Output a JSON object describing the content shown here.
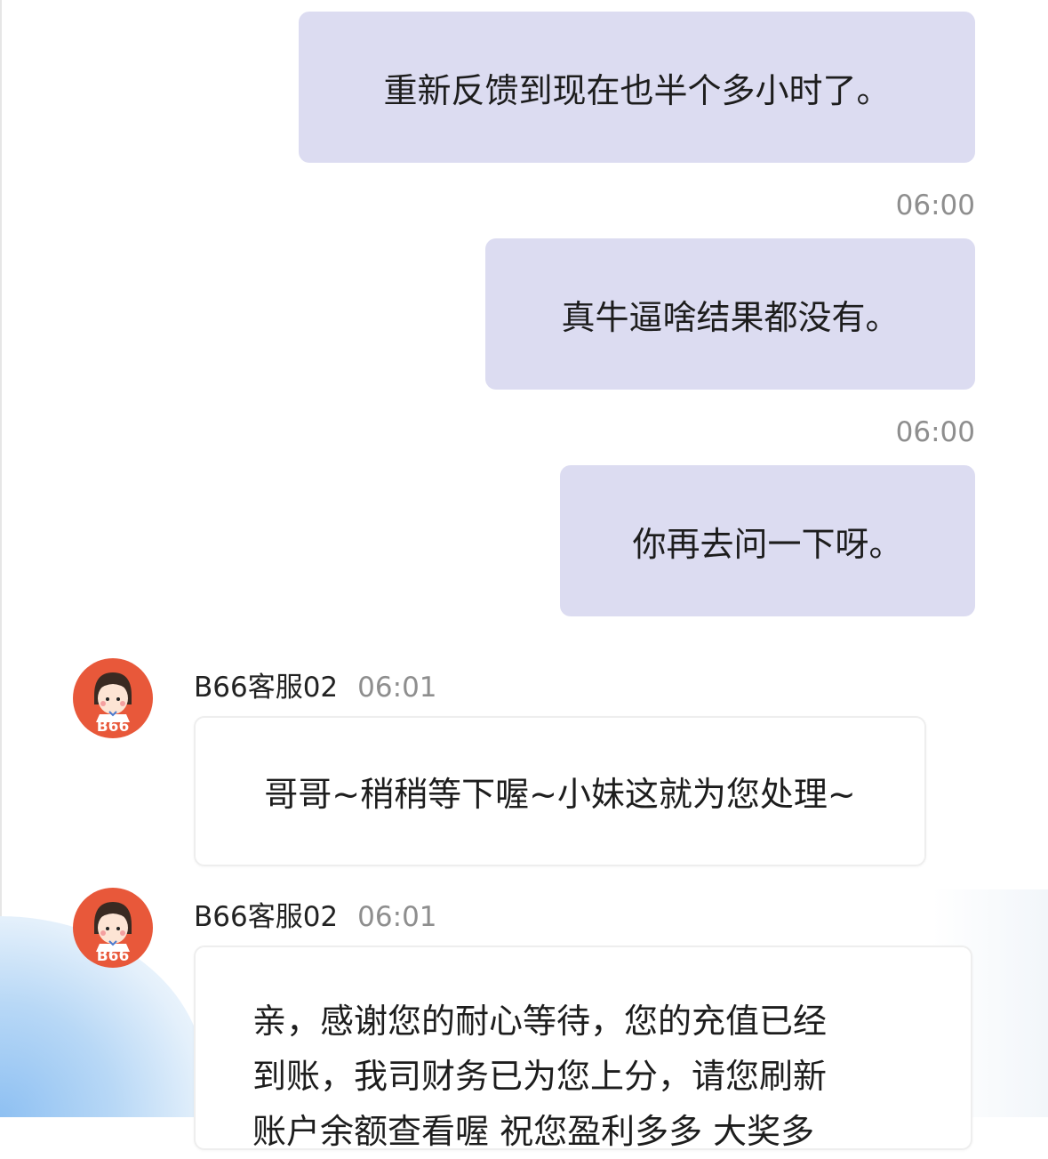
{
  "messages_out": [
    {
      "text": "重新反馈到现在也半个多小时了。"
    },
    {
      "time": "06:00",
      "text": "真牛逼啥结果都没有。"
    },
    {
      "time": "06:00",
      "text": "你再去问一下呀。"
    }
  ],
  "messages_in": [
    {
      "sender": "B66客服02",
      "time": "06:01",
      "avatar_label": "B66",
      "text": "哥哥~稍稍等下喔~小妹这就为您处理~"
    },
    {
      "sender": "B66客服02",
      "time": "06:01",
      "avatar_label": "B66",
      "lines": [
        "亲，感谢您的耐心等待，您的充值已经",
        "到账，我司财务已为您上分，请您刷新",
        "账户余额查看喔 祝您盈利多多 大奖多"
      ]
    }
  ],
  "colors": {
    "outgoing_bubble": "#dcdcf1",
    "avatar_bg": "#e8583a",
    "timestamp": "#8e8e8e"
  }
}
